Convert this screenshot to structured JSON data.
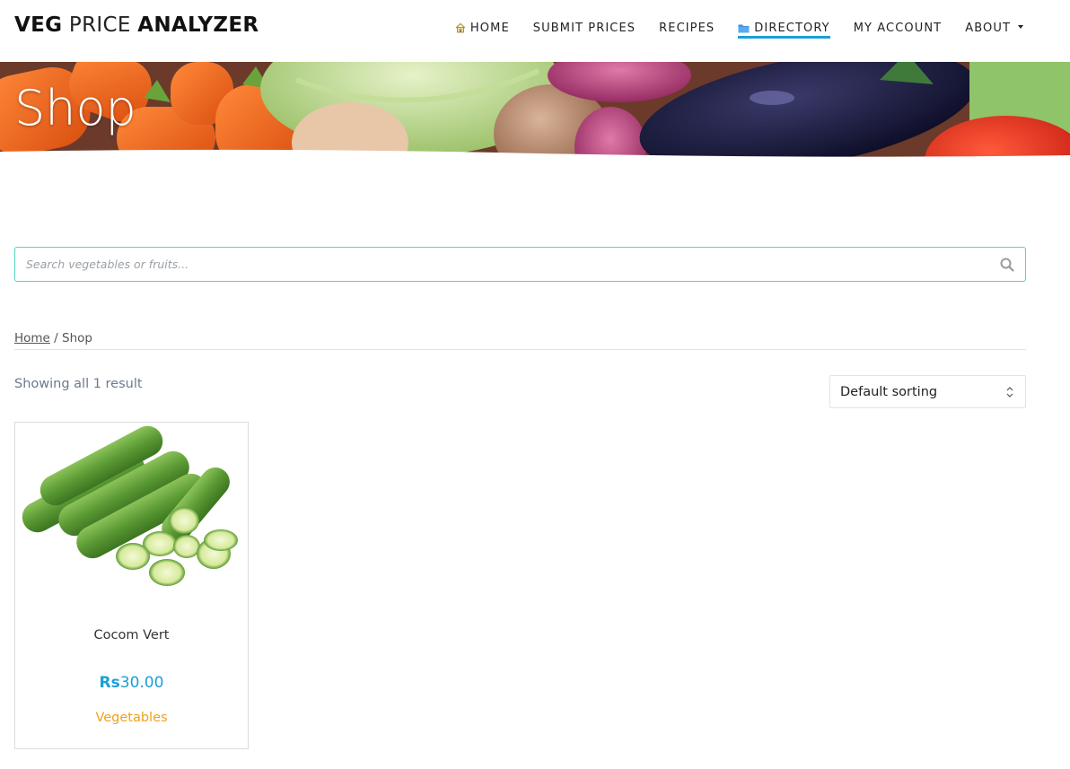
{
  "site": {
    "logo_part1": "VEG",
    "logo_part2": "PRICE",
    "logo_part3": "ANALYZER"
  },
  "nav": {
    "items": [
      {
        "label": "HOME",
        "icon": "home-icon"
      },
      {
        "label": "SUBMIT PRICES"
      },
      {
        "label": "RECIPES"
      },
      {
        "label": "DIRECTORY",
        "icon": "folder-icon",
        "active": true
      },
      {
        "label": "MY ACCOUNT"
      },
      {
        "label": "ABOUT",
        "dropdown": true
      }
    ]
  },
  "banner": {
    "title": "Shop"
  },
  "search": {
    "placeholder": "Search vegetables or fruits...",
    "value": ""
  },
  "breadcrumb": {
    "home": "Home",
    "separator": " / ",
    "current": "Shop"
  },
  "results": {
    "count_text": "Showing all 1 result"
  },
  "sorting": {
    "selected": "Default sorting"
  },
  "products": [
    {
      "name": "Cocom Vert",
      "currency": "Rs",
      "price": "30.00",
      "category": "Vegetables",
      "image": "cucumbers"
    }
  ],
  "colors": {
    "accent": "#1a9fd6",
    "category": "#f0a019",
    "search_border": "#4fd6c0"
  }
}
